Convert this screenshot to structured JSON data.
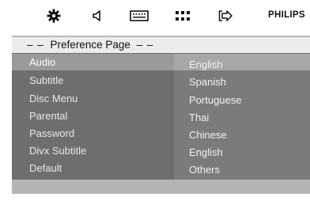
{
  "toolbar": {
    "icons": [
      "gear-icon",
      "speaker-icon",
      "subtitle-icon",
      "grid-icon",
      "exit-icon"
    ],
    "brand": "PHILIPS"
  },
  "header": {
    "dashes_left": "– –",
    "title": "Preference Page",
    "dashes_right": "– –"
  },
  "menu": {
    "items": [
      {
        "label": "Audio",
        "active": true
      },
      {
        "label": "Subtitle"
      },
      {
        "label": "Disc Menu"
      },
      {
        "label": "Parental"
      },
      {
        "label": "Password"
      },
      {
        "label": "Divx Subtitle"
      },
      {
        "label": "Default"
      }
    ]
  },
  "options": {
    "items": [
      "English",
      "Spanish",
      "Portuguese",
      "Thai",
      "Chinese",
      "English",
      "Others"
    ],
    "selected_index": 0
  },
  "colors": {
    "menu_bg": "#6e6e6e",
    "header_bg": "#ececec",
    "highlight": "#9a9a9a"
  }
}
